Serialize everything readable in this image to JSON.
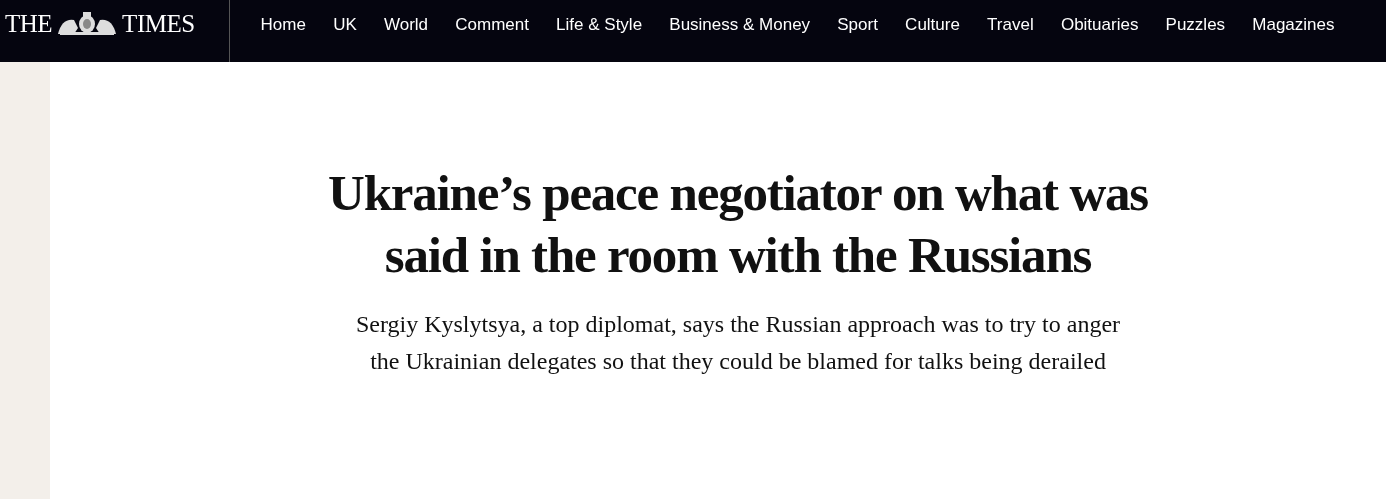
{
  "masthead": {
    "logo_left": "THE",
    "logo_right": "TIMES"
  },
  "nav": [
    "Home",
    "UK",
    "World",
    "Comment",
    "Life & Style",
    "Business & Money",
    "Sport",
    "Culture",
    "Travel",
    "Obituaries",
    "Puzzles",
    "Magazines"
  ],
  "article": {
    "headline": "Ukraine’s peace negotiator on what was said in the room with the Russians",
    "standfirst": "Sergiy Kyslytsya, a top diplomat, says the Russian approach was to try to anger the Ukrainian delegates so that they could be blamed for talks being derailed"
  }
}
